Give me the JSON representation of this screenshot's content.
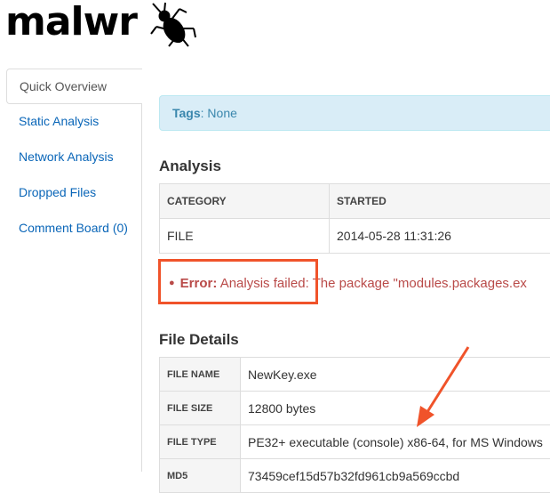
{
  "header": {
    "logo_text": "malwr"
  },
  "sidebar": {
    "items": [
      {
        "label": "Quick Overview",
        "active": true
      },
      {
        "label": "Static Analysis"
      },
      {
        "label": "Network Analysis"
      },
      {
        "label": "Dropped Files"
      },
      {
        "label": "Comment Board (0)"
      }
    ]
  },
  "tags": {
    "label": "Tags",
    "value": ": None"
  },
  "analysis": {
    "heading": "Analysis",
    "columns": [
      "CATEGORY",
      "STARTED"
    ],
    "row": {
      "category": "FILE",
      "started": "2014-05-28 11:31:26"
    },
    "error": {
      "label": "Error:",
      "message": "Analysis failed: The package \"modules.packages.ex"
    }
  },
  "file_details": {
    "heading": "File Details",
    "rows": [
      {
        "key": "FILE NAME",
        "value": "NewKey.exe"
      },
      {
        "key": "FILE SIZE",
        "value": "12800 bytes"
      },
      {
        "key": "FILE TYPE",
        "value": "PE32+ executable (console) x86-64, for MS Windows"
      },
      {
        "key": "MD5",
        "value": "73459cef15d57b32fd961cb9a569ccbd"
      }
    ]
  },
  "colors": {
    "link": "#0a66b8",
    "error": "#b94a48",
    "annotation": "#f0532a",
    "tags_bg": "#d9edf7"
  }
}
